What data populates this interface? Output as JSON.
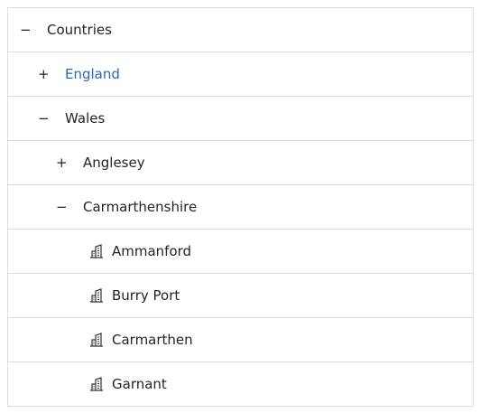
{
  "tree": {
    "nodes": [
      {
        "label": "Countries",
        "toggle": "−"
      },
      {
        "label": "England",
        "toggle": "+"
      },
      {
        "label": "Wales",
        "toggle": "−"
      },
      {
        "label": "Anglesey",
        "toggle": "+"
      },
      {
        "label": "Carmarthenshire",
        "toggle": "−"
      },
      {
        "label": "Ammanford",
        "icon": "building-icon"
      },
      {
        "label": "Burry Port",
        "icon": "building-icon"
      },
      {
        "label": "Carmarthen",
        "icon": "building-icon"
      },
      {
        "label": "Garnant",
        "icon": "building-icon"
      }
    ]
  },
  "colors": {
    "link": "#2a6ab0",
    "text": "#212529",
    "border": "#dcdcdc"
  }
}
